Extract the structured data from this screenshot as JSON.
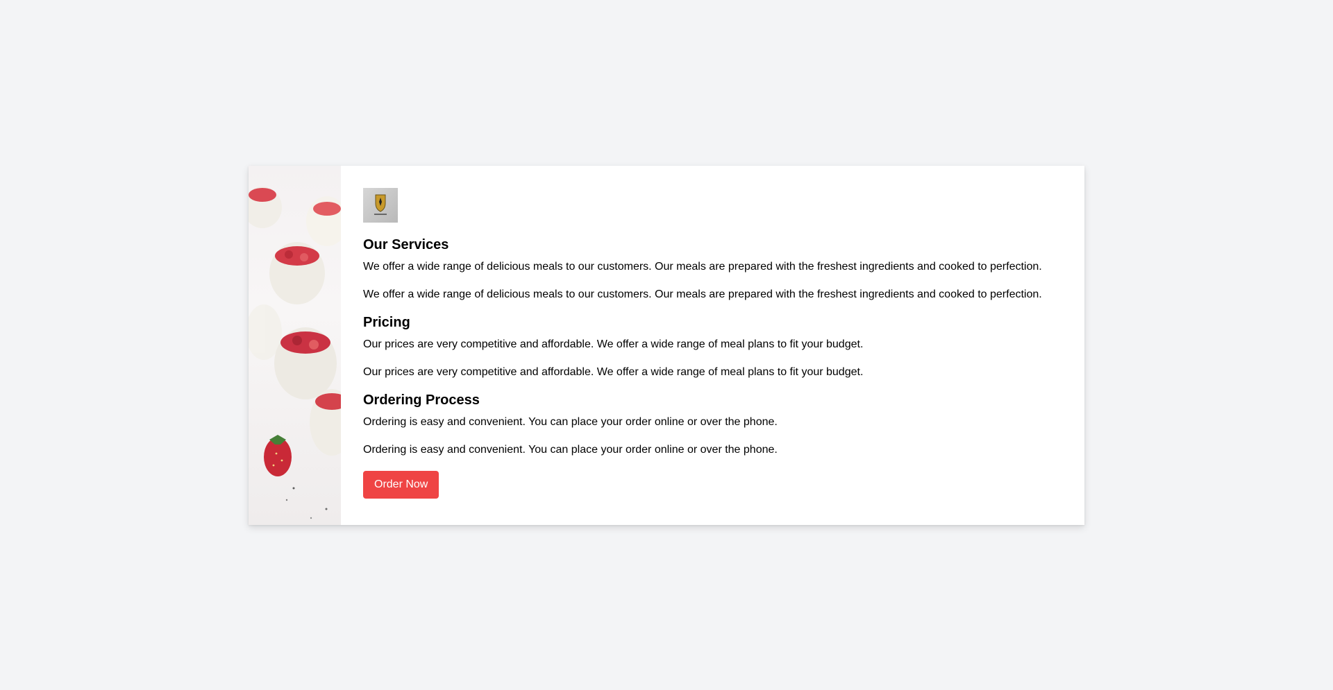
{
  "sections": [
    {
      "title": "Our Services",
      "paragraphs": [
        "We offer a wide range of delicious meals to our customers. Our meals are prepared with the freshest ingredients and cooked to perfection.",
        "We offer a wide range of delicious meals to our customers. Our meals are prepared with the freshest ingredients and cooked to perfection."
      ]
    },
    {
      "title": "Pricing",
      "paragraphs": [
        "Our prices are very competitive and affordable. We offer a wide range of meal plans to fit your budget.",
        "Our prices are very competitive and affordable. We offer a wide range of meal plans to fit your budget."
      ]
    },
    {
      "title": "Ordering Process",
      "paragraphs": [
        "Ordering is easy and convenient. You can place your order online or over the phone.",
        "Ordering is easy and convenient. You can place your order online or over the phone."
      ]
    }
  ],
  "cta": {
    "label": "Order Now"
  },
  "colors": {
    "page_background": "#f3f4f6",
    "card_background": "#ffffff",
    "button_background": "#ef4444",
    "button_text": "#ffffff"
  },
  "images": {
    "side": "strawberry-dessert-jars-photo",
    "logo": "porsche-crest-logo"
  }
}
